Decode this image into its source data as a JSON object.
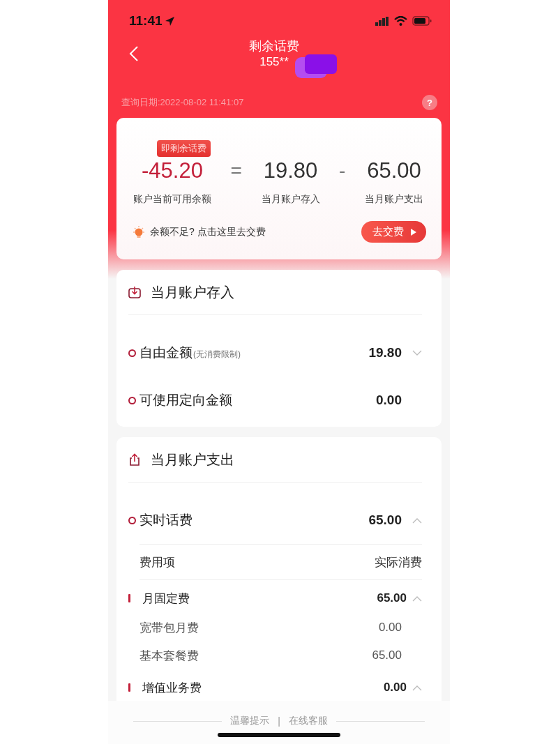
{
  "status_bar": {
    "time": "11:41"
  },
  "header": {
    "title": "剩余话费",
    "phone": "155**",
    "query_date": "查询日期:2022-08-02 11:41:07",
    "help": "?"
  },
  "summary": {
    "badge": "即剩余话费",
    "items": [
      {
        "kind": "result",
        "value": "-45.20",
        "label": "账户当前可用余额"
      },
      {
        "kind": "term",
        "value": "19.80",
        "label": "当月账户存入"
      },
      {
        "kind": "term",
        "value": "65.00",
        "label": "当月账户支出"
      }
    ],
    "operators": [
      "=",
      "-"
    ],
    "tip": "余额不足? 点击这里去交费",
    "pay_button": "去交费"
  },
  "income": {
    "title": "当月账户存入",
    "rows": [
      {
        "name": "自由金额",
        "note": "(无消费限制)",
        "amount": "19.80",
        "expanded": false
      },
      {
        "name": "可使用定向金额",
        "amount": "0.00"
      }
    ]
  },
  "expense": {
    "title": "当月账户支出",
    "group": {
      "name": "实时话费",
      "amount": "65.00",
      "expanded": true
    },
    "columns": [
      "费用项",
      "实际消费"
    ],
    "categories": [
      {
        "name": "月固定费",
        "amount": "65.00",
        "expanded": true,
        "items": [
          {
            "name": "宽带包月费",
            "amount": "0.00"
          },
          {
            "name": "基本套餐费",
            "amount": "65.00"
          }
        ]
      },
      {
        "name": "增值业务费",
        "amount": "0.00",
        "expanded": true
      }
    ]
  },
  "footer": {
    "links": [
      "温馨提示",
      "在线客服"
    ],
    "separator": "|"
  }
}
